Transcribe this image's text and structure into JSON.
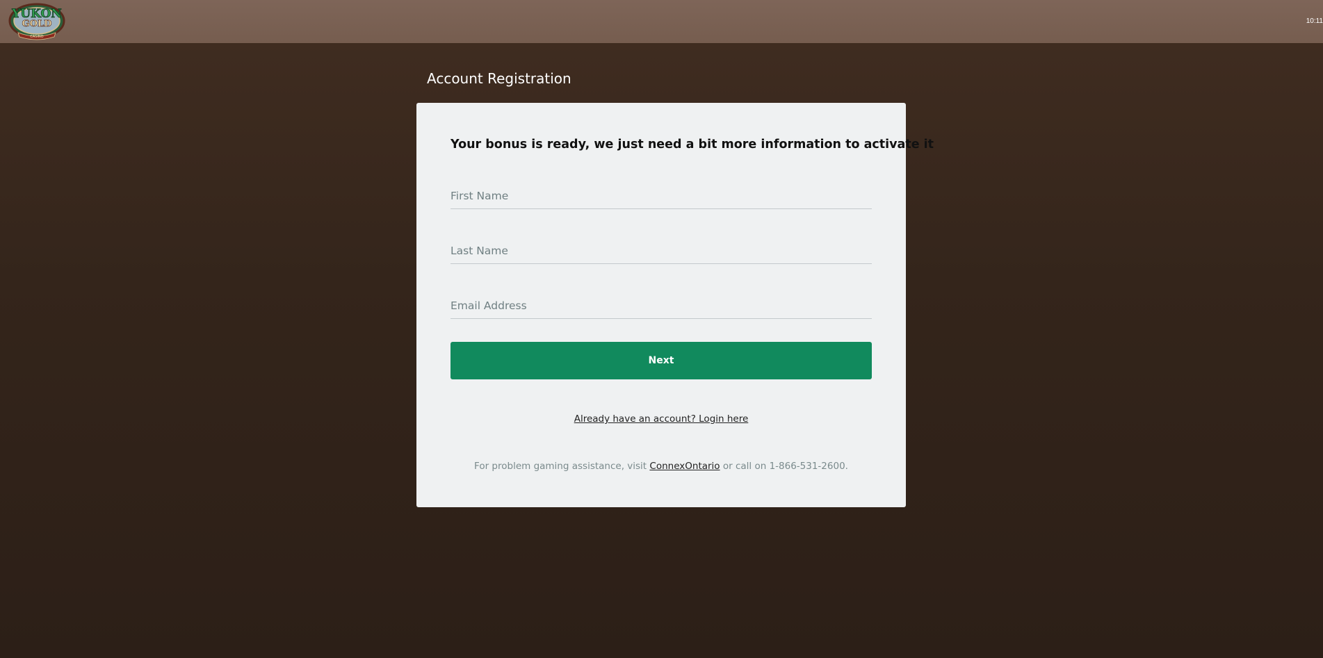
{
  "header": {
    "logo": {
      "icon": "yukon-gold-casino-logo",
      "line1": "YUKON",
      "line2": "GOLD",
      "line3": "CASINO"
    },
    "clock": "10:11"
  },
  "page": {
    "title": "Account Registration"
  },
  "form": {
    "heading": "Your bonus is ready, we just need a bit more information to activate it",
    "first_name_placeholder": "First Name",
    "last_name_placeholder": "Last Name",
    "email_placeholder": "Email Address",
    "next_label": "Next",
    "login_link": "Already have an account? Login here"
  },
  "footer": {
    "prefix": "For problem gaming assistance, visit ",
    "link": "ConnexOntario",
    "suffix": " or call on 1-866-531-2600."
  },
  "colors": {
    "header_bg": "#7b6254",
    "page_bg": "#2c1f17",
    "card_bg": "#eff1f2",
    "button": "#118a5d"
  }
}
